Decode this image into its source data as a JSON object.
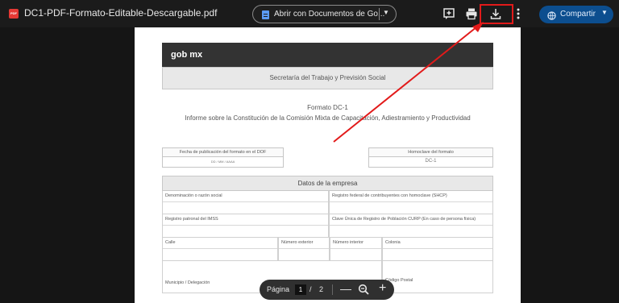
{
  "topbar": {
    "file_badge": "PDF",
    "title": "DC1-PDF-Formato-Editable-Descargable.pdf",
    "open_with_label": "Abrir con Documentos de Go...",
    "share_label": "Compartir"
  },
  "document": {
    "header_logo": "gob mx",
    "secretaria": "Secretaría del Trabajo y Previsión Social",
    "formato_title": "Formato DC-1",
    "formato_subtitle": "Informe sobre la Constitución de la Comisión Mixta de Capacitación, Adiestramiento y Productividad",
    "fecha_label": "Fecha de publicación del formato en el DOF",
    "fecha_placeholder": "DD / MM / AAAA",
    "homoclave_label": "Homoclave del formato",
    "homoclave_value": "DC-1",
    "datos_empresa": "Datos de la empresa",
    "fields": {
      "denominacion": "Denominación o razón social",
      "rfc": "Registro federal de contribuyentes con homoclave (SHCP)",
      "imss": "Registro patronal del IMSS",
      "curp": "Clave Única de Registro de Población CURP (En caso de persona física)",
      "calle": "Calle",
      "num_ext": "Número exterior",
      "num_int": "Número interior",
      "colonia": "Colonia",
      "municipio": "Municipio / Delegación",
      "cp": "Código Postal"
    }
  },
  "pager": {
    "label": "Página",
    "current": "1",
    "separator": "/",
    "total": "2"
  },
  "colors": {
    "highlight": "#e21a1a",
    "share_bg": "#0c4e8f",
    "pdf_badge": "#e53935"
  }
}
